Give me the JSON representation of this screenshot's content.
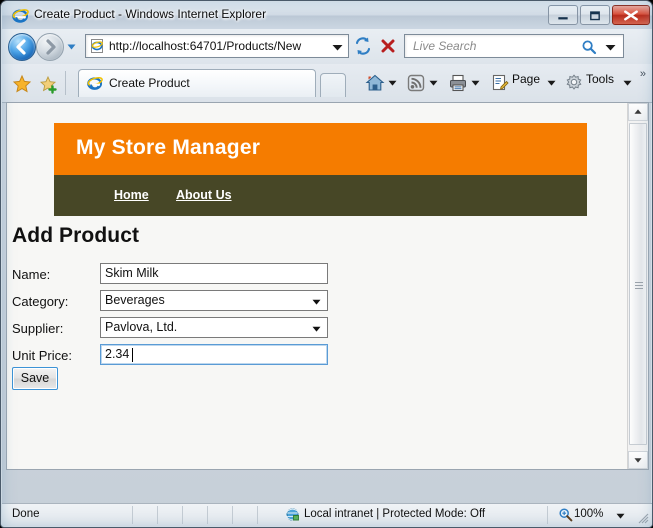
{
  "window": {
    "title": "Create Product - Windows Internet Explorer",
    "icon": "ie-icon",
    "controls": {
      "minimize": "minimize-button",
      "maximize": "maximize-button",
      "close": "close-button"
    }
  },
  "navbar": {
    "back": "back-button",
    "forward": "forward-button",
    "recent_pages": "recent-pages-dropdown",
    "address": "http://localhost:64701/Products/New",
    "address_dropdown": "address-dropdown",
    "refresh": "refresh-button",
    "stop": "stop-button",
    "search_placeholder": "Live Search",
    "search_value": "",
    "search_icon": "search-icon",
    "search_dropdown": "search-provider-dropdown"
  },
  "tabbar": {
    "favorites": "favorites-star-icon",
    "add_favorite": "add-favorite-icon",
    "tabs": [
      {
        "label": "Create Product",
        "icon": "ie-icon",
        "active": true
      }
    ],
    "new_tab": "new-tab-button",
    "commands": [
      {
        "name": "home",
        "label": "",
        "icon": "home-icon",
        "has_caret": true
      },
      {
        "name": "feeds",
        "label": "",
        "icon": "rss-icon",
        "has_caret": true
      },
      {
        "name": "print",
        "label": "",
        "icon": "printer-icon",
        "has_caret": true
      },
      {
        "name": "page",
        "label": "Page",
        "icon": "page-icon",
        "has_caret": true
      },
      {
        "name": "tools",
        "label": "Tools",
        "icon": "gear-icon",
        "has_caret": true
      }
    ],
    "overflow": "»"
  },
  "page": {
    "banner_title": "My Store Manager",
    "nav_links": [
      {
        "label": "Home"
      },
      {
        "label": "About Us"
      }
    ],
    "heading": "Add Product",
    "form": {
      "fields": [
        {
          "label": "Name:",
          "type": "text",
          "value": "Skim Milk",
          "focused": false
        },
        {
          "label": "Category:",
          "type": "select",
          "value": "Beverages",
          "focused": false
        },
        {
          "label": "Supplier:",
          "type": "select",
          "value": "Pavlova, Ltd.",
          "focused": false
        },
        {
          "label": "Unit Price:",
          "type": "text",
          "value": "2.34",
          "focused": true
        }
      ],
      "submit_label": "Save"
    },
    "colors": {
      "banner": "#f57c00",
      "nav": "#474726",
      "background": "#f7f7f5",
      "focus_border": "#5a9bd5"
    }
  },
  "statusbar": {
    "status": "Done",
    "zone_icon": "intranet-globe-icon",
    "zone": "Local intranet | Protected Mode: Off",
    "zoom_icon": "zoom-magnifier-icon",
    "zoom": "100%",
    "zoom_dropdown": "zoom-dropdown"
  }
}
